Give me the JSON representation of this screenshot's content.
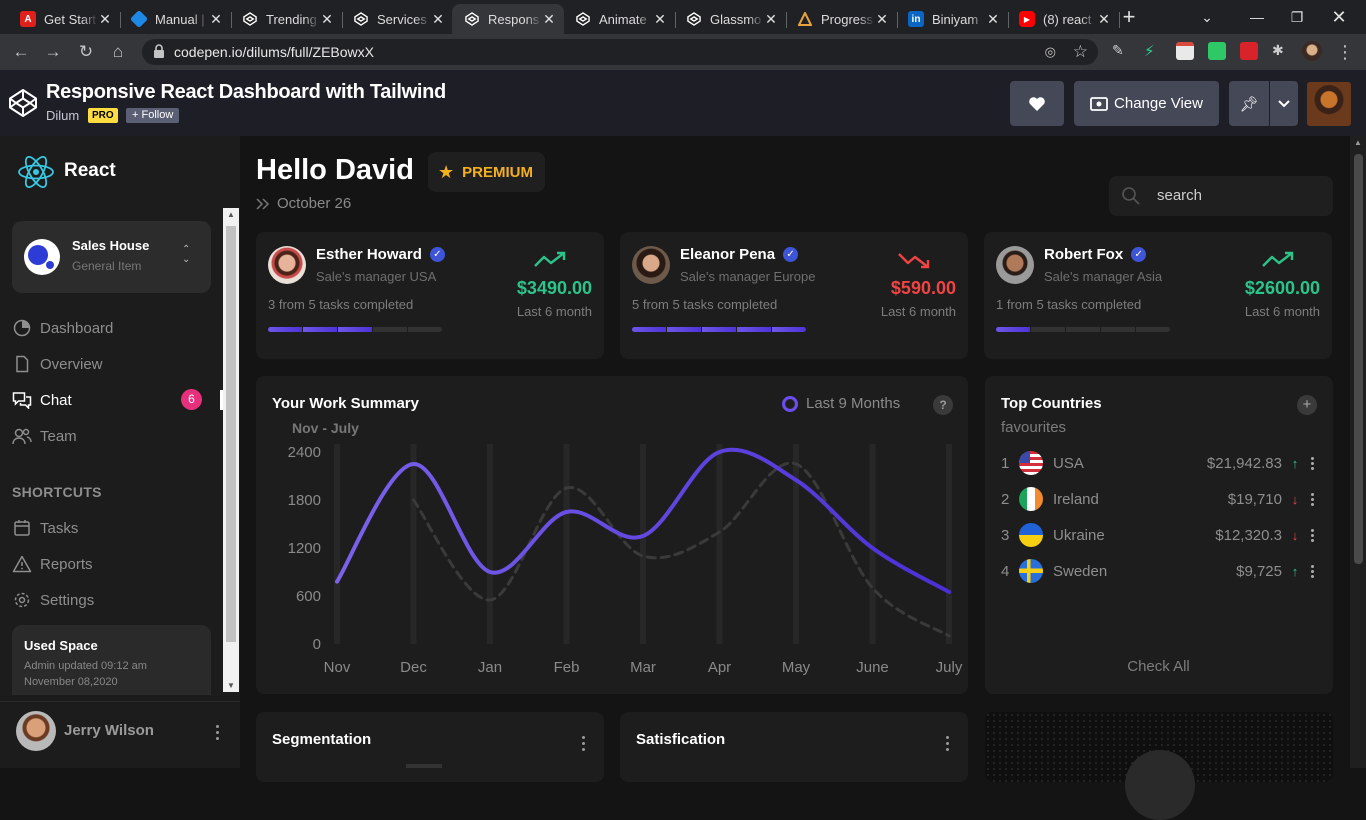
{
  "browser": {
    "tabs": [
      {
        "title": "Get Start",
        "favicon": "adobe-icon",
        "color": "#e0201b"
      },
      {
        "title": "Manual |",
        "favicon": "box-icon",
        "color": "#1e88e5"
      },
      {
        "title": "Trending",
        "favicon": "codepen-icon",
        "color": "#ffffff"
      },
      {
        "title": "Services",
        "favicon": "codepen-icon",
        "color": "#ffffff"
      },
      {
        "title": "Respons",
        "favicon": "codepen-icon",
        "color": "#ffffff"
      },
      {
        "title": "Animate",
        "favicon": "codepen-icon",
        "color": "#ffffff"
      },
      {
        "title": "Glassmo",
        "favicon": "codepen-icon",
        "color": "#ffffff"
      },
      {
        "title": "Progress",
        "favicon": "triangle-icon",
        "color": "#e8a33d"
      },
      {
        "title": "Biniyam",
        "favicon": "linkedin-icon",
        "color": "#0a66c2"
      },
      {
        "title": "(8) react",
        "favicon": "youtube-icon",
        "color": "#ff0000"
      }
    ],
    "active_tab": 4,
    "url": "codepen.io/dilums/full/ZEBowxX"
  },
  "codepen": {
    "title": "Responsive React Dashboard with Tailwind",
    "author": "Dilum",
    "pro_badge": "PRO",
    "follow_label": "+ Follow",
    "change_view_label": "Change View"
  },
  "sidebar": {
    "brand": "React",
    "team": {
      "name": "Sales House",
      "subtitle": "General Item"
    },
    "nav": [
      {
        "label": "Dashboard",
        "icon": "dashboard-icon"
      },
      {
        "label": "Overview",
        "icon": "document-icon"
      },
      {
        "label": "Chat",
        "icon": "chat-icon",
        "badge": "6",
        "active": true
      },
      {
        "label": "Team",
        "icon": "team-icon"
      }
    ],
    "shortcuts_title": "SHORTCUTS",
    "shortcuts": [
      {
        "label": "Tasks",
        "icon": "calendar-icon"
      },
      {
        "label": "Reports",
        "icon": "warning-icon"
      },
      {
        "label": "Settings",
        "icon": "gear-icon"
      }
    ],
    "storage": {
      "title": "Used Space",
      "subtitle": "Admin updated 09:12 am November 08,2020"
    },
    "user": {
      "name": "Jerry Wilson"
    }
  },
  "header": {
    "greeting": "Hello David",
    "premium_label": "PREMIUM",
    "date": "October 26",
    "search_placeholder": "search"
  },
  "people": [
    {
      "name": "Esther Howard",
      "role": "Sale's manager USA",
      "tasks": "3 from 5 tasks completed",
      "done": 3,
      "total": 5,
      "amount": "$3490.00",
      "period": "Last 6 month",
      "trend": "up",
      "color": "#2bc48a"
    },
    {
      "name": "Eleanor Pena",
      "role": "Sale's manager Europe",
      "tasks": "5 from 5 tasks completed",
      "done": 5,
      "total": 5,
      "amount": "$590.00",
      "period": "Last 6 month",
      "trend": "down",
      "color": "#f04444"
    },
    {
      "name": "Robert Fox",
      "role": "Sale's manager Asia",
      "tasks": "1 from 5 tasks completed",
      "done": 1,
      "total": 5,
      "amount": "$2600.00",
      "period": "Last 6 month",
      "trend": "up",
      "color": "#2bc48a"
    }
  ],
  "work_summary": {
    "title": "Your Work Summary",
    "range": "Nov - July",
    "legend": "Last 9 Months",
    "help": "?"
  },
  "chart_data": {
    "type": "line",
    "title": "Your Work Summary",
    "categories": [
      "Nov",
      "Dec",
      "Jan",
      "Feb",
      "Mar",
      "Apr",
      "May",
      "June",
      "July"
    ],
    "yticks": [
      "2400",
      "1800",
      "1200",
      "600",
      "0"
    ],
    "ylim": [
      0,
      2400
    ],
    "grid": false,
    "series": [
      {
        "name": "",
        "style": "solid",
        "color": "#6a4ff0",
        "values": [
          780,
          2250,
          900,
          1650,
          1350,
          2400,
          2050,
          1200,
          650
        ]
      },
      {
        "name": "",
        "style": "dashed",
        "color": "#3a3a3a",
        "values": [
          null,
          1800,
          550,
          1950,
          1100,
          1400,
          2250,
          700,
          100
        ]
      }
    ]
  },
  "top_countries": {
    "title": "Top Countries",
    "subtitle": "favourites",
    "rows": [
      {
        "rank": "1",
        "name": "USA",
        "value": "$21,942.83",
        "trend": "up",
        "flag": "usa-flag-icon"
      },
      {
        "rank": "2",
        "name": "Ireland",
        "value": "$19,710",
        "trend": "down",
        "flag": "ireland-flag-icon"
      },
      {
        "rank": "3",
        "name": "Ukraine",
        "value": "$12,320.3",
        "trend": "down",
        "flag": "ukraine-flag-icon"
      },
      {
        "rank": "4",
        "name": "Sweden",
        "value": "$9,725",
        "trend": "up",
        "flag": "sweden-flag-icon"
      }
    ],
    "check_all": "Check All"
  },
  "bottom_cards": {
    "segmentation": "Segmentation",
    "satisfication": "Satisfication"
  },
  "colors": {
    "accent": "#5b3fe0",
    "up": "#2bc48a",
    "down": "#f04444",
    "premium": "#f5b020",
    "badge": "#e7307b"
  }
}
